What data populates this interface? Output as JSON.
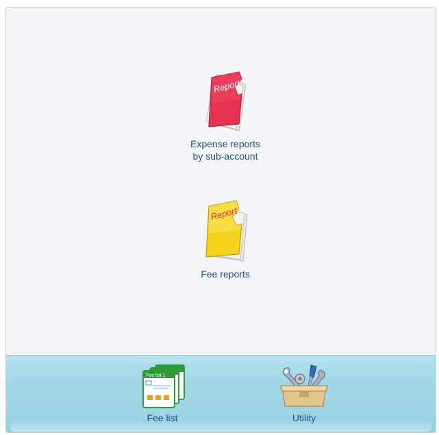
{
  "main": {
    "items": [
      {
        "label_line1": "Expense reports",
        "label_line2": "by sub-account",
        "icon_text": "Report",
        "icon": "red-report-folder-icon"
      },
      {
        "label_line1": "Fee reports",
        "icon_text": "Report",
        "icon": "yellow-report-folder-icon"
      }
    ]
  },
  "footer": {
    "items": [
      {
        "label": "Fee list",
        "icon_text": "Fee list 1",
        "icon": "fee-list-cards-icon"
      },
      {
        "label": "Utility",
        "icon": "toolbox-icon"
      }
    ]
  },
  "colors": {
    "panel_bg": "#f4f5f9",
    "label": "#1f4f84",
    "footer_bg": "#9fd6e6",
    "red_report": "#e4324f",
    "yellow_report": "#f6d21c",
    "fee_list_green": "#2f9a3a"
  }
}
